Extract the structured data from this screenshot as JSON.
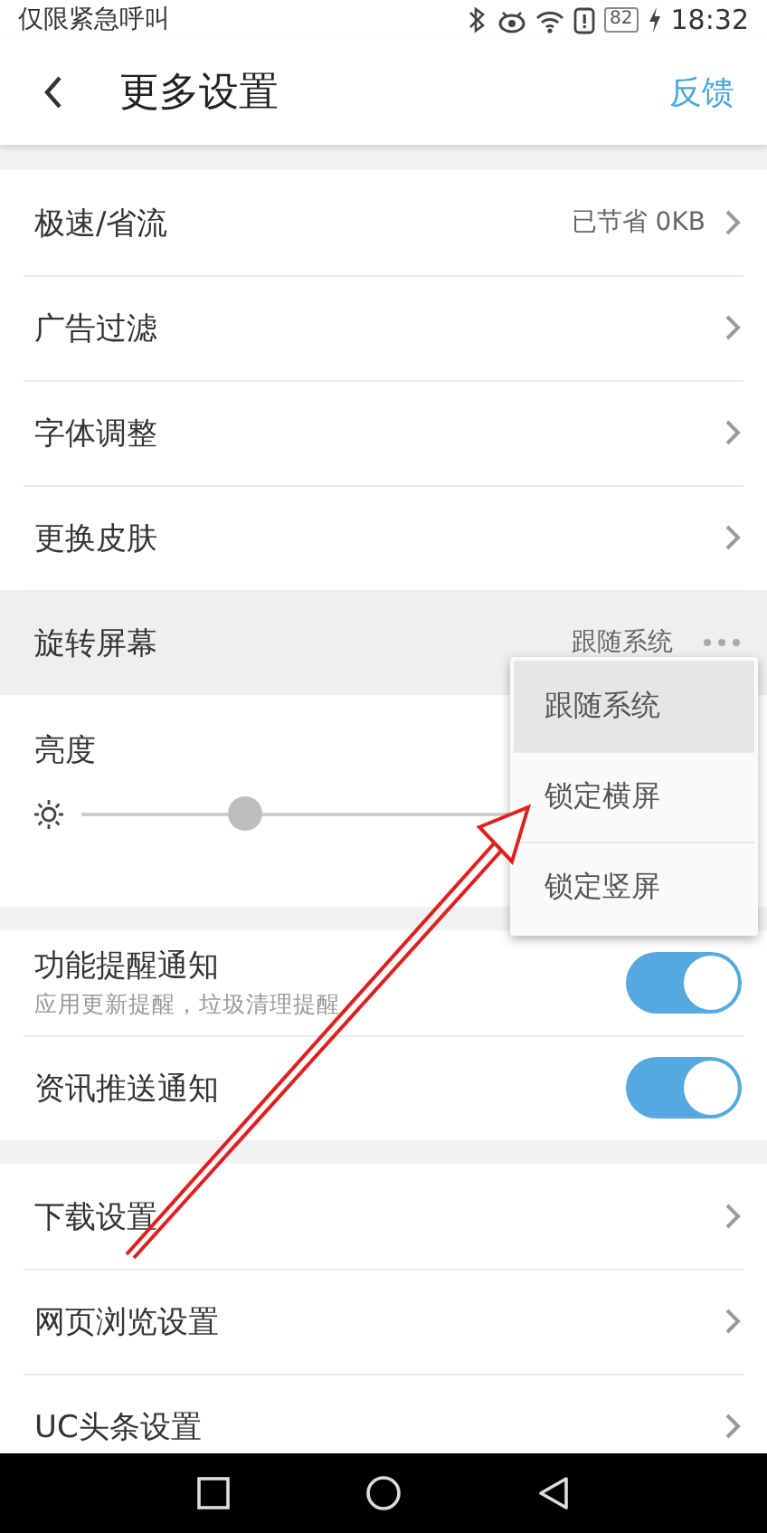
{
  "status_bar": {
    "carrier": "仅限紧急呼叫",
    "battery": "82",
    "time": "18:32"
  },
  "header": {
    "title": "更多设置",
    "action": "反馈"
  },
  "section_1": [
    {
      "kind": "link",
      "label": "极速/省流",
      "value": "已节省 0KB",
      "pressed": false
    },
    {
      "kind": "link",
      "label": "广告过滤",
      "pressed": false
    },
    {
      "kind": "link",
      "label": "字体调整",
      "pressed": false
    },
    {
      "kind": "link",
      "label": "更换皮肤",
      "pressed": false
    },
    {
      "kind": "select",
      "label": "旋转屏幕",
      "value": "跟随系统",
      "pressed": true
    }
  ],
  "brightness": {
    "label": "亮度",
    "level": 0.25
  },
  "notifications": [
    {
      "label": "功能提醒通知",
      "subtitle": "应用更新提醒，垃圾清理提醒",
      "on": true
    },
    {
      "label": "资讯推送通知",
      "on": true
    }
  ],
  "section_3": [
    {
      "kind": "link",
      "label": "下载设置",
      "pressed": false
    },
    {
      "kind": "link",
      "label": "网页浏览设置",
      "pressed": false
    },
    {
      "kind": "link",
      "label": "UC头条设置",
      "pressed": false
    }
  ],
  "popup_menu": [
    {
      "label": "跟随系统",
      "selected": true
    },
    {
      "label": "锁定横屏",
      "selected": false
    },
    {
      "label": "锁定竖屏",
      "selected": false
    }
  ]
}
